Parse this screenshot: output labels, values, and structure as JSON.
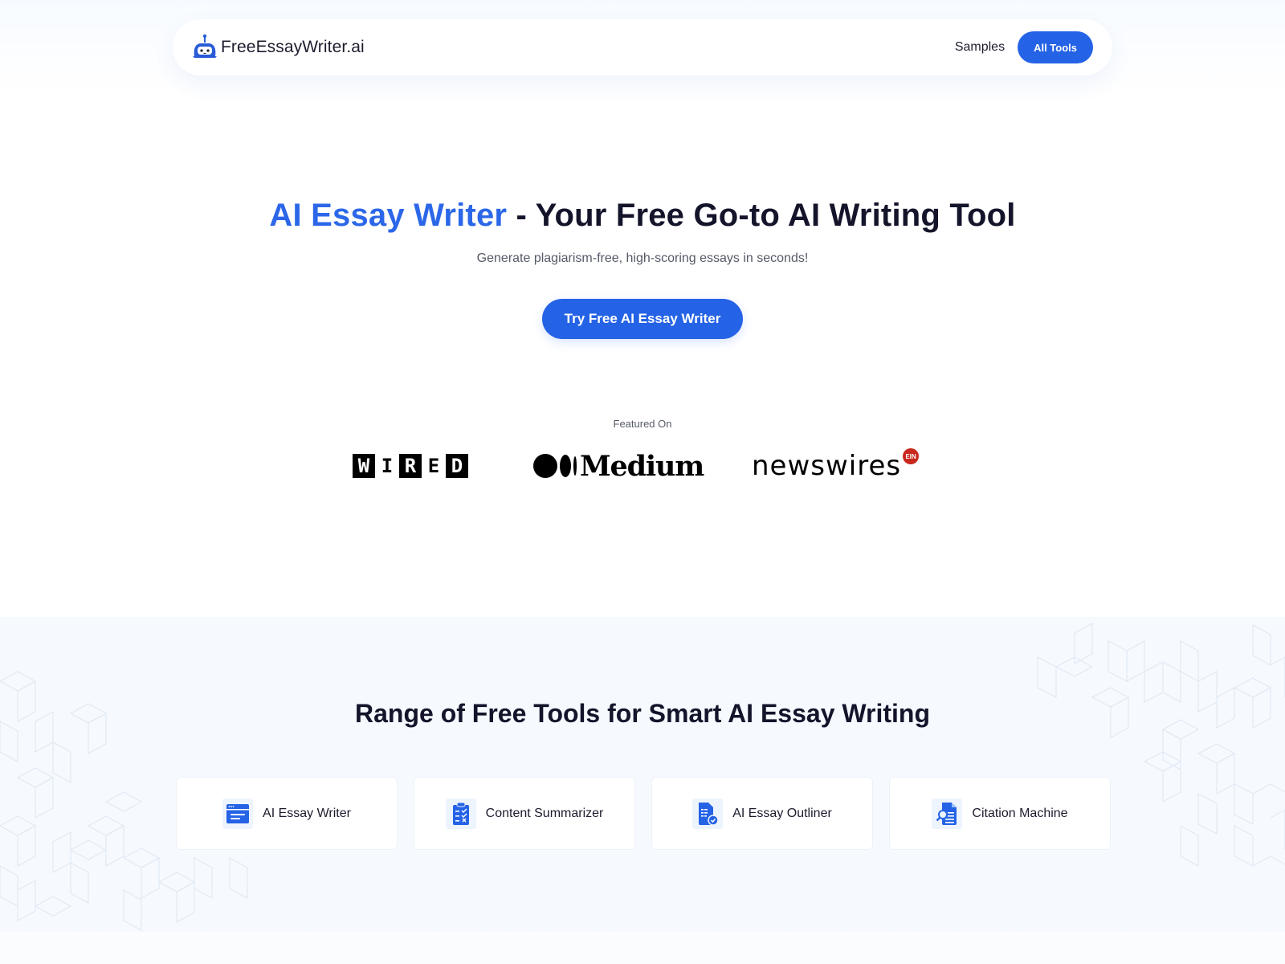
{
  "nav": {
    "brand": "FreeEssayWriter.ai",
    "links": [
      "Samples"
    ],
    "all_tools_label": "All Tools"
  },
  "hero": {
    "title_accent": "AI Essay Writer",
    "title_rest": " - Your Free Go-to AI Writing Tool",
    "subtitle": "Generate plagiarism-free, high-scoring essays in seconds!",
    "cta_label": "Try Free AI Essay Writer"
  },
  "featured": {
    "label": "Featured On",
    "logos": {
      "wired": [
        "W",
        "I",
        "R",
        "E",
        "D"
      ],
      "medium": "Medium",
      "newswires": "newswires",
      "ein": "EIN"
    }
  },
  "tools": {
    "title": "Range of Free Tools for Smart AI Essay Writing",
    "items": [
      {
        "label": "AI Essay Writer",
        "icon": "browser-window-icon"
      },
      {
        "label": "Content Summarizer",
        "icon": "clipboard-checklist-icon"
      },
      {
        "label": "AI Essay Outliner",
        "icon": "document-check-icon"
      },
      {
        "label": "Citation Machine",
        "icon": "document-search-icon"
      }
    ]
  },
  "colors": {
    "accent": "#2563e6",
    "heading": "#14142b",
    "section_bg": "#f6faff"
  }
}
